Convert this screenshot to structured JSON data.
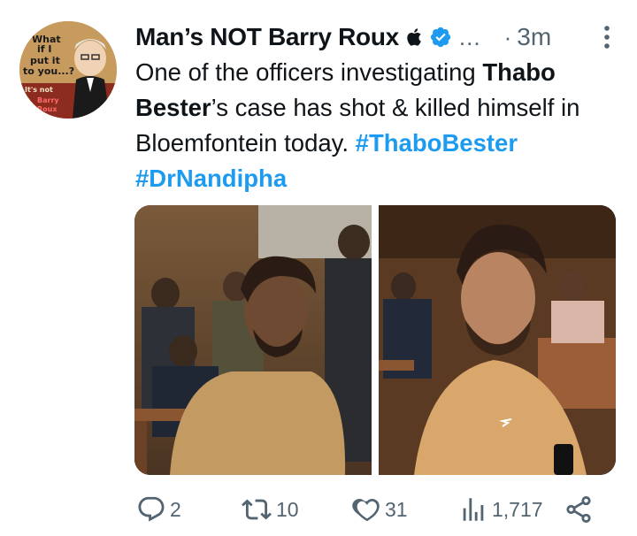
{
  "author": {
    "display_name": "Man’s NOT Barry Roux",
    "handle_truncated": "...",
    "separator": "·",
    "time": "3m",
    "avatar_caption_lines": [
      "What",
      "if I",
      "put it",
      "to you...?",
      "It's not",
      "Barry",
      "Roux"
    ]
  },
  "tweet": {
    "part1": "One of the officers investigating ",
    "bold1": "Thabo Bester",
    "part2": "’s case has shot & killed himself in Bloemfontein today. ",
    "hashtag1": "#ThaboBester",
    "hashtag2": "#DrNandipha"
  },
  "actions": {
    "replies": "2",
    "retweets": "10",
    "likes": "31",
    "views": "1,717"
  },
  "icons": {
    "apple": "apple-icon",
    "verified": "verified-badge-icon",
    "more": "more-options-icon",
    "reply": "reply-icon",
    "retweet": "retweet-icon",
    "like": "heart-icon",
    "views": "views-chart-icon",
    "share": "share-icon"
  },
  "colors": {
    "accent": "#1d9bf0",
    "text": "#0f1419",
    "muted": "#536471"
  }
}
